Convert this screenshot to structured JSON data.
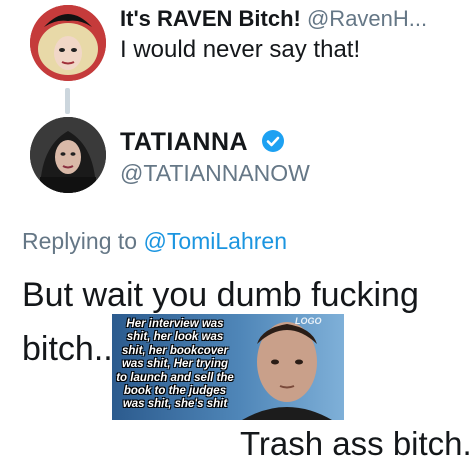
{
  "quoted_tweet": {
    "display_name": "It's RAVEN Bitch!",
    "handle": "@RavenH...",
    "text": "I would never say that!"
  },
  "tweet": {
    "display_name": "TATIANNA",
    "handle": "@TATIANNANOW",
    "verified": true,
    "replying_prefix": "Replying to",
    "replying_to": "@TomiLahren",
    "body_line1": "But wait you dumb fucking",
    "body_line2": "bitch.."
  },
  "meme": {
    "caption_lines": [
      "Her interview was",
      "shit, her look was",
      "shit, her bookcover",
      "was shit, Her trying",
      "to launch and sell the",
      "book to the judges",
      "was shit, she's shit"
    ],
    "logo": "LOGO",
    "footer_text": "Trash ass bitch."
  },
  "colors": {
    "text": "#14171a",
    "secondary": "#657786",
    "link": "#1b95e0",
    "verified": "#1da1f2",
    "thread_line": "#ccd6dd"
  },
  "icons": {
    "verified": "verified-badge-icon"
  }
}
